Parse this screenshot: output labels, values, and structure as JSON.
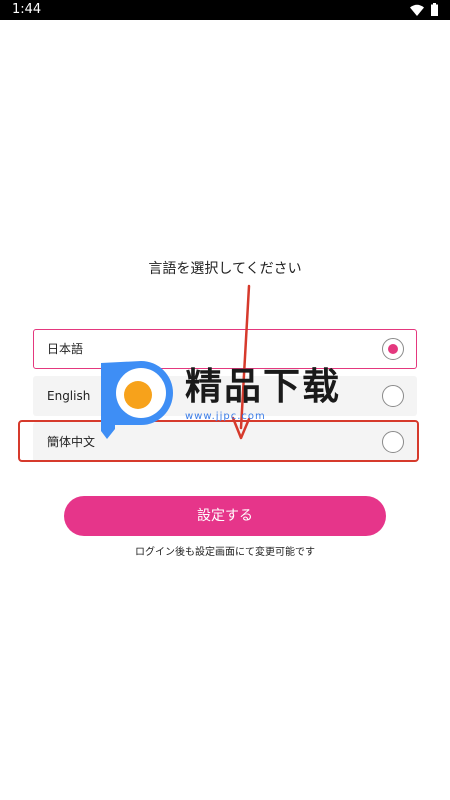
{
  "status_bar": {
    "time": "1:44",
    "icons": [
      "wifi-icon",
      "battery-icon"
    ]
  },
  "title": "言語を選択してください",
  "languages": [
    {
      "label": "日本語",
      "selected": true
    },
    {
      "label": "English",
      "selected": false
    },
    {
      "label": "簡体中文",
      "selected": false
    }
  ],
  "submit_label": "設定する",
  "note": "ログイン後も設定画面にて変更可能です",
  "watermark": {
    "text": "精品下载",
    "url": "www.jjpc.com"
  },
  "colors": {
    "accent": "#e6358a",
    "radio_selected": "#e4387e",
    "annotation": "#d63a2c",
    "option_background": "#f4f4f4"
  }
}
